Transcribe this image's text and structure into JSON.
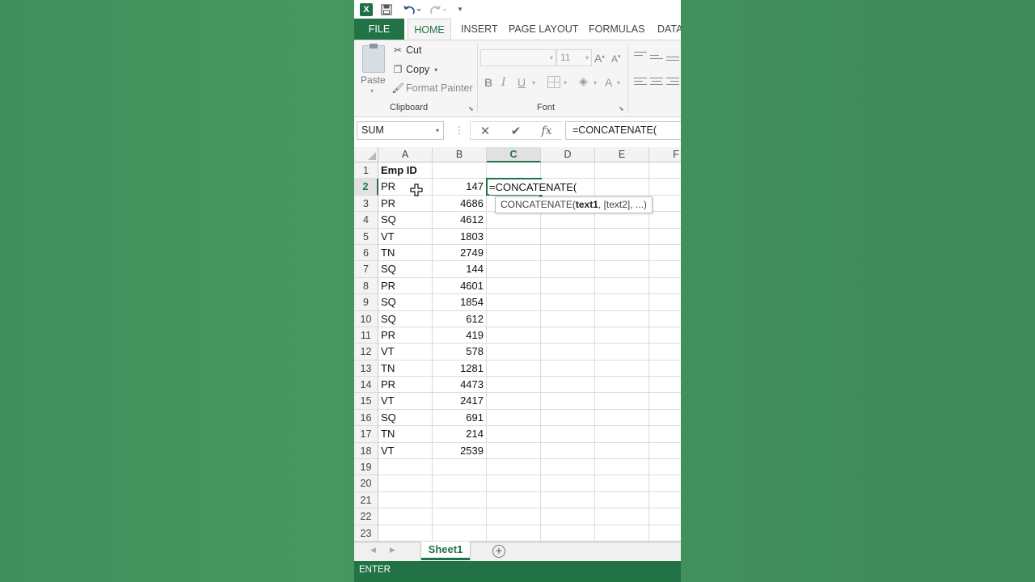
{
  "app": {
    "logo_letter": "X"
  },
  "tabs": [
    "FILE",
    "HOME",
    "INSERT",
    "PAGE LAYOUT",
    "FORMULAS",
    "DATA"
  ],
  "ribbon": {
    "clipboard": {
      "paste": "Paste",
      "cut": "Cut",
      "copy": "Copy",
      "format_painter": "Format Painter",
      "label": "Clipboard"
    },
    "font": {
      "font_name": "",
      "font_size": "11",
      "label": "Font",
      "bold": "B",
      "italic": "I",
      "underline": "U",
      "font_color": "A"
    }
  },
  "formula_bar": {
    "name_box": "SUM",
    "cancel": "✕",
    "enter": "✔",
    "fx": "fx",
    "formula": "=CONCATENATE("
  },
  "columns": [
    "A",
    "B",
    "C",
    "D",
    "E",
    "F"
  ],
  "active_column": "C",
  "active_row": "2",
  "rows": [
    {
      "num": "1",
      "a": "Emp ID",
      "b": ""
    },
    {
      "num": "2",
      "a": "PR",
      "b": "147"
    },
    {
      "num": "3",
      "a": "PR",
      "b": "4686"
    },
    {
      "num": "4",
      "a": "SQ",
      "b": "4612"
    },
    {
      "num": "5",
      "a": "VT",
      "b": "1803"
    },
    {
      "num": "6",
      "a": "TN",
      "b": "2749"
    },
    {
      "num": "7",
      "a": "SQ",
      "b": "144"
    },
    {
      "num": "8",
      "a": "PR",
      "b": "4601"
    },
    {
      "num": "9",
      "a": "SQ",
      "b": "1854"
    },
    {
      "num": "10",
      "a": "SQ",
      "b": "612"
    },
    {
      "num": "11",
      "a": "PR",
      "b": "419"
    },
    {
      "num": "12",
      "a": "VT",
      "b": "578"
    },
    {
      "num": "13",
      "a": "TN",
      "b": "1281"
    },
    {
      "num": "14",
      "a": "PR",
      "b": "4473"
    },
    {
      "num": "15",
      "a": "VT",
      "b": "2417"
    },
    {
      "num": "16",
      "a": "SQ",
      "b": "691"
    },
    {
      "num": "17",
      "a": "TN",
      "b": "214"
    },
    {
      "num": "18",
      "a": "VT",
      "b": "2539"
    },
    {
      "num": "19",
      "a": "",
      "b": ""
    },
    {
      "num": "20",
      "a": "",
      "b": ""
    },
    {
      "num": "21",
      "a": "",
      "b": ""
    },
    {
      "num": "22",
      "a": "",
      "b": ""
    },
    {
      "num": "23",
      "a": "",
      "b": ""
    }
  ],
  "editing_cell": {
    "text": "=CONCATENATE(",
    "tooltip_func": "CONCATENATE(",
    "tooltip_arg1": "text1",
    "tooltip_rest": ", [text2], ...)"
  },
  "sheet_tabs": [
    "Sheet1"
  ],
  "status": {
    "mode": "ENTER"
  },
  "colors": {
    "accent": "#217346",
    "background": "#45965f"
  }
}
